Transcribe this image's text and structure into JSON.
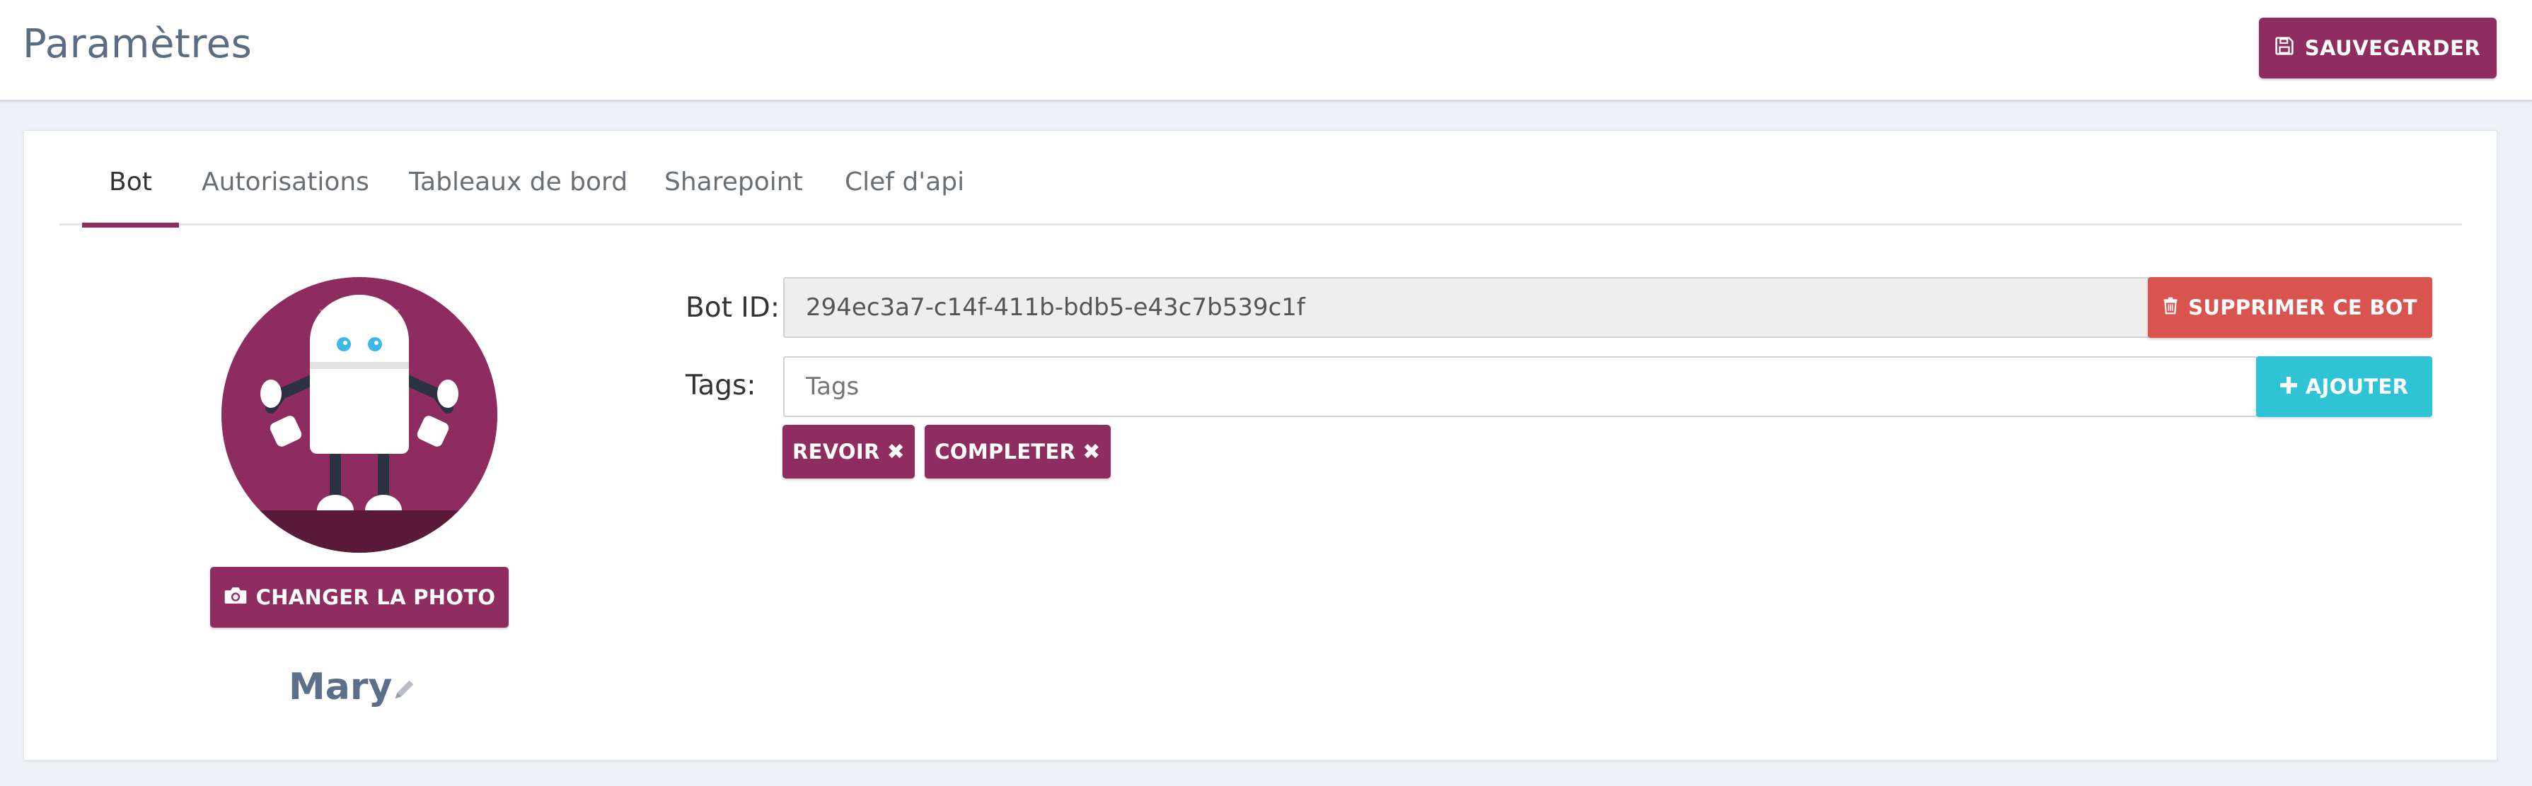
{
  "header": {
    "title": "Paramètres",
    "save_label": "SAUVEGARDER"
  },
  "tabs": [
    {
      "label": "Bot",
      "active": true
    },
    {
      "label": "Autorisations",
      "active": false
    },
    {
      "label": "Tableaux de bord",
      "active": false
    },
    {
      "label": "Sharepoint",
      "active": false
    },
    {
      "label": "Clef d'api",
      "active": false
    }
  ],
  "bot": {
    "name": "Mary",
    "change_photo_label": "CHANGER LA PHOTO",
    "id_label": "Bot ID:",
    "id_value": "294ec3a7-c14f-411b-bdb5-e43c7b539c1f",
    "delete_label": "SUPPRIMER CE BOT",
    "tags_label": "Tags:",
    "tags_placeholder": "Tags",
    "add_label": "AJOUTER",
    "tags": [
      {
        "label": "REVOIR"
      },
      {
        "label": "COMPLETER"
      }
    ]
  },
  "icons": {
    "save": "floppy-disk-icon",
    "camera": "camera-icon",
    "trash": "trash-icon",
    "plus": "plus-icon",
    "remove": "times-icon",
    "edit": "pencil-icon"
  },
  "colors": {
    "primary": "#8f2d60",
    "danger": "#d9534f",
    "info": "#2fc3d6",
    "title": "#5b6d82",
    "name": "#5b6f8a"
  }
}
